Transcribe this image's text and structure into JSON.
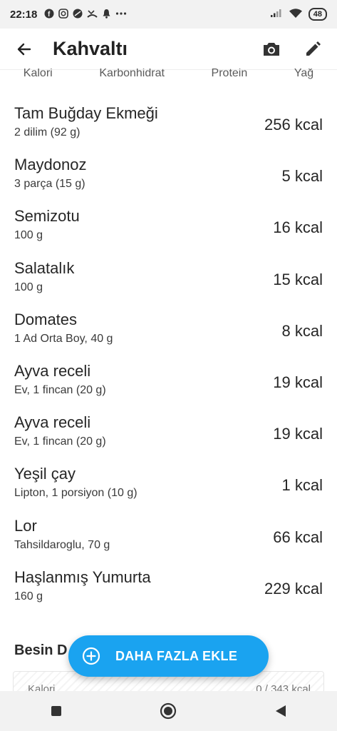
{
  "status_bar": {
    "time": "22:18",
    "battery": "48",
    "icons": [
      "facebook-icon",
      "instagram-icon",
      "app-icon",
      "missed-call-icon",
      "bell-icon",
      "more-icon",
      "signal-icon",
      "wifi-icon",
      "battery-icon"
    ]
  },
  "app_bar": {
    "title": "Kahvaltı",
    "icons": [
      "back-arrow-icon",
      "camera-icon",
      "edit-icon"
    ]
  },
  "macro_header": [
    "Kalori",
    "Karbonhidrat",
    "Protein",
    "Yağ"
  ],
  "foods": [
    {
      "name": "Tam Buğday Ekmeği",
      "portion": "2 dilim (92 g)",
      "kcal": "256 kcal"
    },
    {
      "name": "Maydonoz",
      "portion": "3 parça (15 g)",
      "kcal": "5 kcal"
    },
    {
      "name": "Semizotu",
      "portion": "100 g",
      "kcal": "16 kcal"
    },
    {
      "name": "Salatalık",
      "portion": "100 g",
      "kcal": "15 kcal"
    },
    {
      "name": "Domates",
      "portion": "1 Ad Orta Boy, 40 g",
      "kcal": "8 kcal"
    },
    {
      "name": "Ayva receli",
      "portion": "Ev, 1 fincan (20 g)",
      "kcal": "19 kcal"
    },
    {
      "name": "Ayva receli",
      "portion": "Ev, 1 fincan (20 g)",
      "kcal": "19 kcal"
    },
    {
      "name": "Yeşil çay",
      "portion": "Lipton, 1 porsiyon (10 g)",
      "kcal": "1 kcal"
    },
    {
      "name": "Lor",
      "portion": "Tahsildaroglu, 70 g",
      "kcal": "66 kcal"
    },
    {
      "name": "Haşlanmış Yumurta",
      "portion": "160 g",
      "kcal": "229 kcal"
    }
  ],
  "section": {
    "title": "Besin D"
  },
  "nutrient_row": {
    "label": "Kalori",
    "value": "0 / 343 kcal"
  },
  "fab": {
    "label": "DAHA FAZLA EKLE",
    "color": "#1aa3f0"
  },
  "nav": [
    "recents-square-icon",
    "home-circle-icon",
    "back-triangle-icon"
  ]
}
